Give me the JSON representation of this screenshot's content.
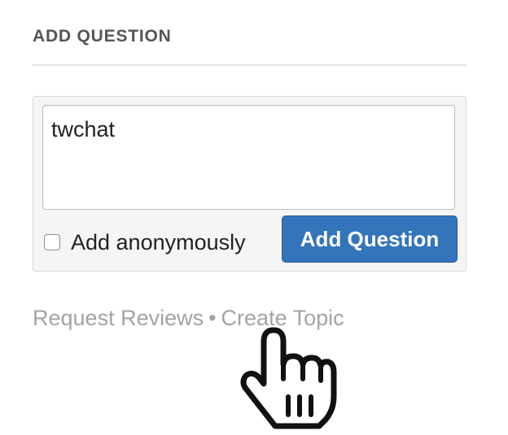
{
  "add_question": {
    "title": "ADD QUESTION",
    "input_value": "twchat",
    "anonymous_label": "Add anonymously",
    "anonymous_checked": false,
    "submit_label": "Add Question"
  },
  "links": {
    "request_reviews": "Request Reviews",
    "separator": "•",
    "create_topic": "Create Topic"
  },
  "cursor": {
    "icon": "hand-pointer-icon"
  },
  "colors": {
    "accent": "#3374bb",
    "link_gray": "#a3a3a3",
    "heading": "#555555"
  }
}
